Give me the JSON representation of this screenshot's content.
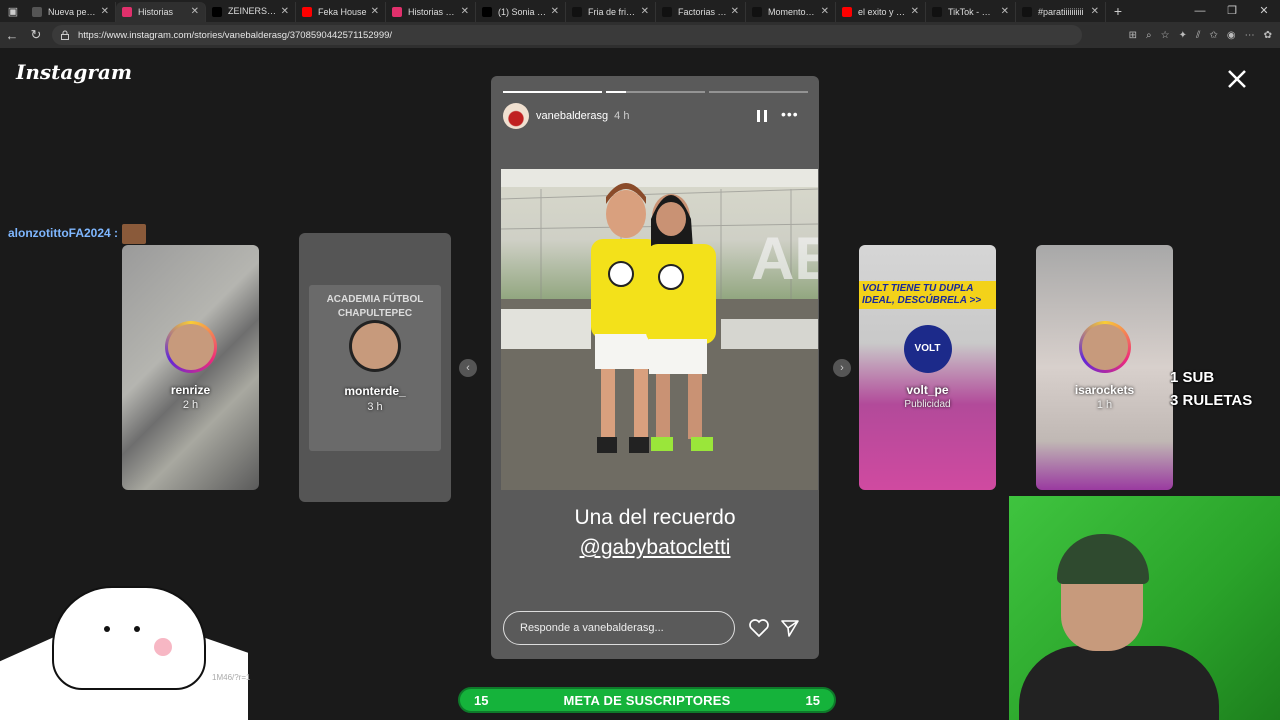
{
  "browser": {
    "tabs": [
      {
        "label": "Nueva pestaña",
        "favicon_color": "#555555"
      },
      {
        "label": "Historias",
        "favicon_color": "#e1306c",
        "active": true
      },
      {
        "label": "ZEINERS 😳 C",
        "favicon_color": "#000000"
      },
      {
        "label": "Feka House",
        "favicon_color": "#ff0000"
      },
      {
        "label": "Historias • Inst",
        "favicon_color": "#e1306c"
      },
      {
        "label": "(1) Sonia Lope",
        "favicon_color": "#000000"
      },
      {
        "label": "Fria de frias #c",
        "favicon_color": "#111111"
      },
      {
        "label": "Factorias #ch",
        "favicon_color": "#111111"
      },
      {
        "label": "MomentoStre",
        "favicon_color": "#111111"
      },
      {
        "label": "el exito y caid",
        "favicon_color": "#ff0000"
      },
      {
        "label": "TikTok - Make",
        "favicon_color": "#111111"
      },
      {
        "label": "#paratiiiiiiiiii",
        "favicon_color": "#111111"
      }
    ],
    "url": "https://www.instagram.com/stories/vanebalderasg/3708590442571152999/"
  },
  "instagram": {
    "logo": "Instagram",
    "chat_user": "alonzotittoFA2024 :",
    "stories_left": [
      {
        "name": "renrize",
        "time": "2 h"
      },
      {
        "name": "monterde_",
        "time": "3 h"
      }
    ],
    "stories_right": [
      {
        "name": "volt_pe",
        "time": "Publicidad",
        "banner": "VOLT TIENE TU DUPLA IDEAL, DESCÚBRELA >>",
        "brand": "VOLT"
      },
      {
        "name": "isarockets",
        "time": "1 h"
      }
    ],
    "monterde_poster_title": "ACADEMIA FÚTBOL CHAPULTEPEC",
    "main_story": {
      "user": "vanebalderasg",
      "time": "4 h",
      "caption_line1": "Una del recuerdo",
      "caption_line2": "@gabybatocletti",
      "reply_placeholder": "Responde a vanebalderasg...",
      "progress_segments": 3,
      "current_segment": 2,
      "current_progress": 0.2
    }
  },
  "stream_overlay": {
    "sub_text_1": "1 SUB",
    "sub_text_2": "3 RULETAS",
    "goal_left": "15",
    "goal_label": "META DE SUSCRIPTORES",
    "goal_right": "15",
    "url_snip": "1M46/?r=1"
  }
}
